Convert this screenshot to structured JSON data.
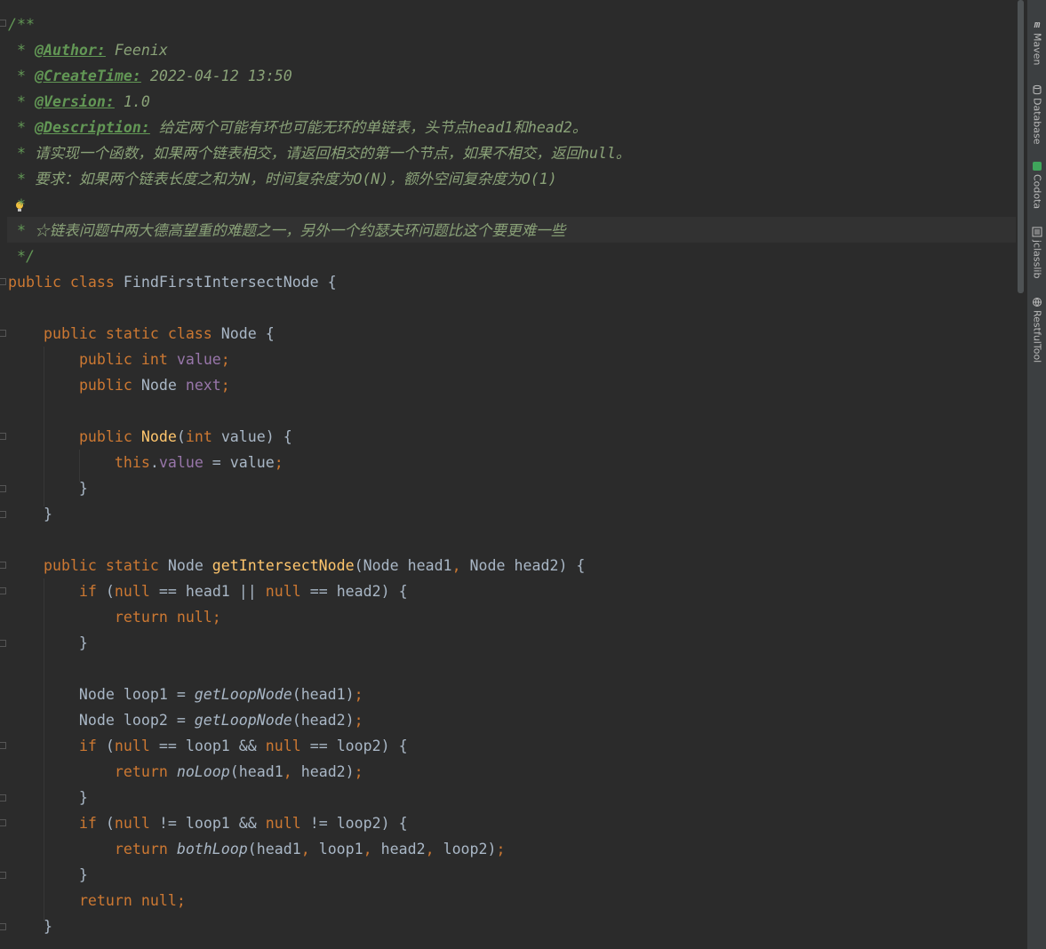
{
  "comment": {
    "open": "/**",
    "author_tag": "@Author:",
    "author_value": "Feenix",
    "createtime_tag": "@CreateTime:",
    "createtime_value": "2022-04-12 13:50",
    "version_tag": "@Version:",
    "version_value": "1.0",
    "description_tag": "@Description:",
    "description_value": "给定两个可能有环也可能无环的单链表，头节点head1和head2。",
    "line5": "请实现一个函数，如果两个链表相交，请返回相交的第一个节点，如果不相交，返回null。",
    "line6": "要求：如果两个链表长度之和为N，时间复杂度为O(N)，额外空间复杂度为O(1)",
    "line8": "☆链表问题中两大德高望重的难题之一，另外一个约瑟夫环问题比这个要更难一些",
    "close": "*/"
  },
  "code": {
    "class_name": "FindFirstIntersectNode",
    "inner_class": "Node",
    "field_value": "value",
    "field_next": "next",
    "method_main": "getIntersectNode",
    "call_getloop": "getLoopNode",
    "call_noloop": "noLoop",
    "call_bothloop": "bothLoop"
  },
  "right_toolbar": [
    {
      "label": "Maven",
      "icon": "maven-icon"
    },
    {
      "label": "Database",
      "icon": "database-icon"
    },
    {
      "label": "Codota",
      "icon": "codota-icon"
    },
    {
      "label": "jclasslib",
      "icon": "jclasslib-icon"
    },
    {
      "label": "RestfulTool",
      "icon": "restfultool-icon"
    }
  ],
  "colors": {
    "background": "#2b2b2b",
    "keyword": "#cc7832",
    "field": "#9876aa",
    "method": "#ffc66d",
    "comment": "#629755",
    "text": "#a9b7c6"
  }
}
